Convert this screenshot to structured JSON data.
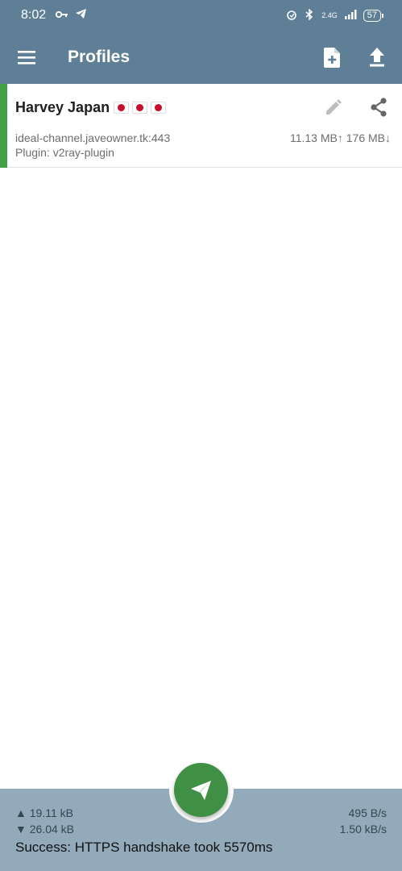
{
  "status_bar": {
    "time": "8:02",
    "battery": "57",
    "network_label": "2.4G"
  },
  "app_bar": {
    "title": "Profiles"
  },
  "profile": {
    "name": "Harvey Japan",
    "flags": [
      "jp-flag",
      "jp-flag",
      "jp-flag"
    ],
    "server": "ideal-channel.javeowner.tk:443",
    "plugin": "Plugin: v2ray-plugin",
    "traffic": "11.13 MB↑ 176 MB↓",
    "accent_color": "#43a047"
  },
  "bottom_bar": {
    "tx_total": "▲ 19.11 kB",
    "rx_total": "▼ 26.04 kB",
    "tx_rate": "495 B/s",
    "rx_rate": "1.50 kB/s",
    "status": "Success: HTTPS handshake took 5570ms"
  },
  "colors": {
    "primary": "#5f7f96",
    "bottom_bar": "#93aabb",
    "fab": "#3f8f44"
  }
}
